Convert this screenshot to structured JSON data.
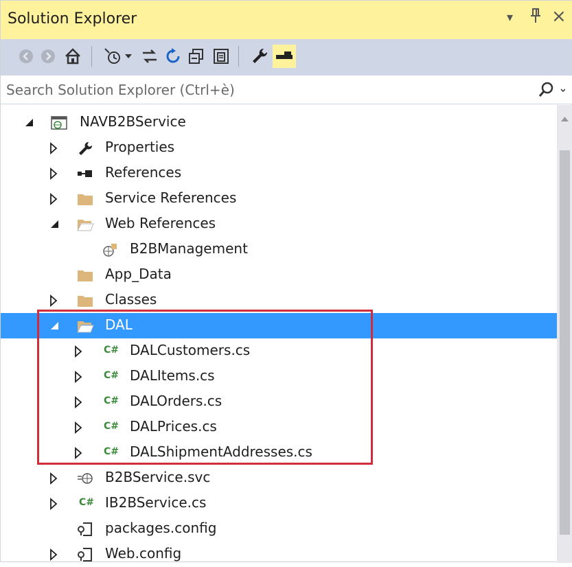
{
  "panel": {
    "title": "Solution Explorer",
    "dropdown_glyph": "▾",
    "pin_glyph": "ᵖ",
    "close_glyph": "×"
  },
  "toolbar": {
    "icons": [
      "back-icon",
      "forward-icon",
      "home-icon",
      "pending-changes-icon",
      "dropdown-icon",
      "sync-icon",
      "refresh-icon",
      "collapse-all-icon",
      "show-all-files-icon",
      "properties-icon",
      "preview-icon"
    ]
  },
  "search": {
    "placeholder": "Search Solution Explorer (Ctrl+è)",
    "icon": "search-icon"
  },
  "tree": {
    "project": "NAVB2BService",
    "items": [
      {
        "label": "NAVB2BService",
        "icon": "web-project-icon",
        "expander": "expanded"
      },
      {
        "label": "Properties",
        "icon": "wrench-icon",
        "expander": "collapsed"
      },
      {
        "label": "References",
        "icon": "references-icon",
        "expander": "collapsed"
      },
      {
        "label": "Service References",
        "icon": "folder-icon",
        "expander": "collapsed"
      },
      {
        "label": "Web References",
        "icon": "folder-open-icon",
        "expander": "expanded"
      },
      {
        "label": "B2BManagement",
        "icon": "web-reference-icon",
        "expander": "none"
      },
      {
        "label": "App_Data",
        "icon": "folder-icon",
        "expander": "none"
      },
      {
        "label": "Classes",
        "icon": "folder-icon",
        "expander": "collapsed"
      },
      {
        "label": "DAL",
        "icon": "folder-open-icon",
        "expander": "expanded",
        "selected": true
      },
      {
        "label": "DALCustomers.cs",
        "icon": "csharp-file-icon",
        "expander": "collapsed"
      },
      {
        "label": "DALItems.cs",
        "icon": "csharp-file-icon",
        "expander": "collapsed"
      },
      {
        "label": "DALOrders.cs",
        "icon": "csharp-file-icon",
        "expander": "collapsed"
      },
      {
        "label": "DALPrices.cs",
        "icon": "csharp-file-icon",
        "expander": "collapsed"
      },
      {
        "label": "DALShipmentAddresses.cs",
        "icon": "csharp-file-icon",
        "expander": "collapsed"
      },
      {
        "label": "B2BService.svc",
        "icon": "wcf-service-icon",
        "expander": "collapsed"
      },
      {
        "label": "IB2BService.cs",
        "icon": "csharp-file-icon",
        "expander": "collapsed"
      },
      {
        "label": "packages.config",
        "icon": "config-file-icon",
        "expander": "none"
      },
      {
        "label": "Web.config",
        "icon": "config-file-icon",
        "expander": "collapsed"
      }
    ],
    "csharp_glyph": "C#"
  },
  "colors": {
    "title_bg": "#fff29d",
    "toolbar_bg": "#cfd6e5",
    "selection": "#3399ff",
    "highlight_box": "#d12c3a",
    "folder": "#dcb67a",
    "csharp": "#3b8a3c"
  }
}
